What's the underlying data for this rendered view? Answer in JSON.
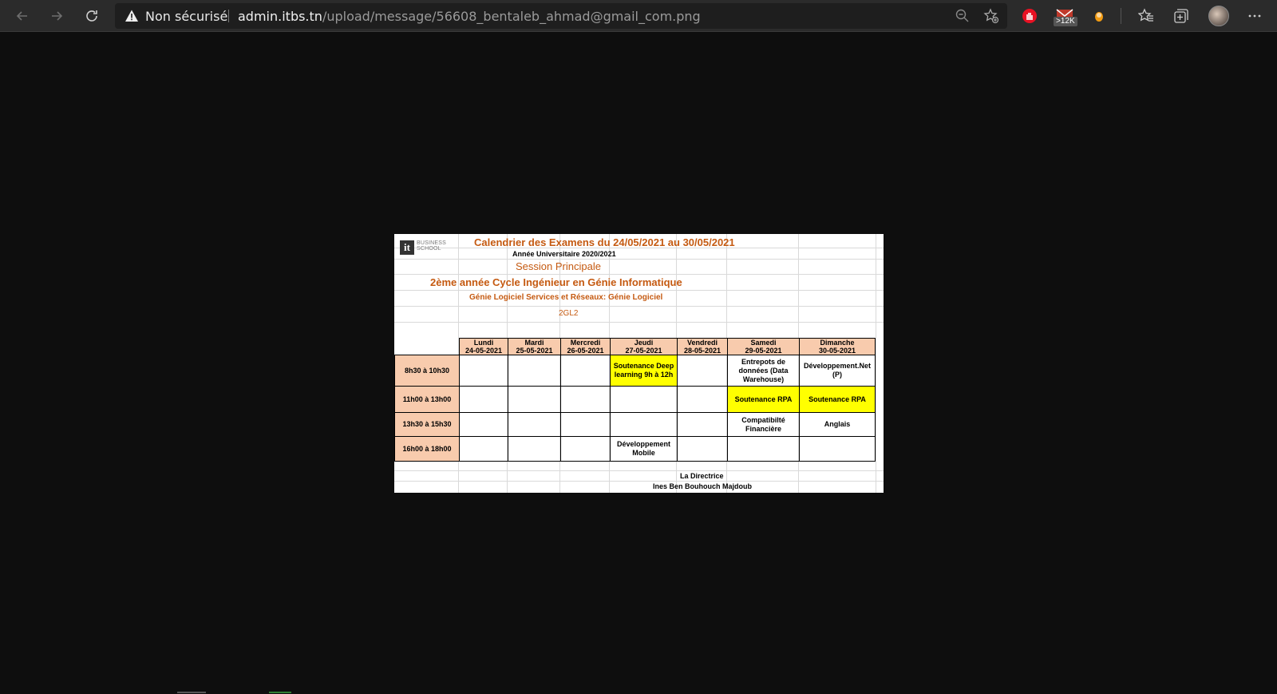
{
  "browser": {
    "security_label": "Non sécurisé",
    "url_host": "admin.itbs.tn",
    "url_path": "/upload/message/56608_bentaleb_ahmad@gmail_com.png",
    "mail_badge": ">12K",
    "icons": [
      "back-icon",
      "forward-icon",
      "refresh-icon",
      "warning-icon",
      "zoom-out-icon",
      "add-favorite-icon",
      "extension-hand-icon",
      "extension-mail-icon",
      "extension-dot-icon",
      "favorites-icon",
      "collections-icon",
      "profile-avatar",
      "more-icon"
    ]
  },
  "document": {
    "logo_letters": "it",
    "logo_text_1": "BUSINESS",
    "logo_text_2": "SCHOOL",
    "title": "Calendrier des Examens du 24/05/2021 au 30/05/2021",
    "academic_year": "Année Universitaire 2020/2021",
    "session": "Session Principale",
    "cycle": "2ème année Cycle Ingénieur en Génie Informatique",
    "specialty": "Génie Logiciel Services et Réseaux: Génie Logiciel",
    "group": "2GL2",
    "days": [
      {
        "name": "Lundi",
        "date": "24-05-2021"
      },
      {
        "name": "Mardi",
        "date": "25-05-2021"
      },
      {
        "name": "Mercredi",
        "date": "26-05-2021"
      },
      {
        "name": "Jeudi",
        "date": "27-05-2021"
      },
      {
        "name": "Vendredi",
        "date": "28-05-2021"
      },
      {
        "name": "Samedi",
        "date": "29-05-2021"
      },
      {
        "name": "Dimanche",
        "date": "30-05-2021"
      }
    ],
    "rows": [
      {
        "slot": "8h30 à 10h30",
        "cells": [
          "",
          "",
          "",
          "Soutenance Deep learning 9h à 12h",
          "",
          "Entrepots de données (Data Warehouse)",
          "Développement.Net (P)"
        ]
      },
      {
        "slot": "11h00 à 13h00",
        "cells": [
          "",
          "",
          "",
          "",
          "",
          "Soutenance RPA",
          "Soutenance RPA"
        ]
      },
      {
        "slot": "13h30 à 15h30",
        "cells": [
          "",
          "",
          "",
          "",
          "",
          "Compatibilté Financière",
          "Anglais"
        ]
      },
      {
        "slot": "16h00 à 18h00",
        "cells": [
          "",
          "",
          "",
          "Développement Mobile",
          "",
          "",
          ""
        ]
      }
    ],
    "signature_role": "La Directrice",
    "signature_name": "Ines Ben Bouhouch Majdoub",
    "colors": {
      "title": "#c55a11",
      "header_fill": "#f8cbad",
      "highlight": "#ffff00",
      "background": "#0e0e0e"
    }
  }
}
